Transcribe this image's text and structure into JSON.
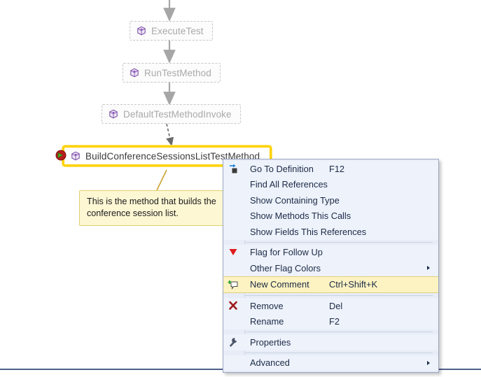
{
  "canvas": {
    "background": "#ffffff",
    "accent_highlight": "#ffd200",
    "comment_fill": "#fdf7d4",
    "comment_border": "#e0d070",
    "node_text": "#a9a9a9",
    "menu_bg": "#eef2fb",
    "menu_border": "#9ba7bf",
    "menu_highlight": "#fdf3c2"
  },
  "graph": {
    "nodes": [
      {
        "id": "execute-test",
        "label": "ExecuteTest",
        "icon": "method-cube-icon",
        "state": "dimmed"
      },
      {
        "id": "run-test-method",
        "label": "RunTestMethod",
        "icon": "method-cube-icon",
        "state": "dimmed"
      },
      {
        "id": "default-test-method-invoke",
        "label": "DefaultTestMethodInvoke",
        "icon": "method-cube-icon",
        "state": "dimmed"
      },
      {
        "id": "build-conference-sessions-list-test-method",
        "label": "BuildConferenceSessionsListTestMethod",
        "icon": "method-cube-icon",
        "state": "selected"
      }
    ],
    "breakpoint": {
      "name": "current-statement-icon",
      "title": "Current statement"
    }
  },
  "comment": {
    "line1": "This is the method that builds the",
    "line2": "conference session list."
  },
  "context_menu": {
    "groups": [
      {
        "items": [
          {
            "label": "Go To Definition",
            "shortcut": "F12",
            "icon": "go-to-definition-icon",
            "submenu": false,
            "highlighted": false
          },
          {
            "label": "Find All References",
            "shortcut": "",
            "icon": "",
            "submenu": false,
            "highlighted": false
          },
          {
            "label": "Show Containing Type",
            "shortcut": "",
            "icon": "",
            "submenu": false,
            "highlighted": false
          },
          {
            "label": "Show Methods This Calls",
            "shortcut": "",
            "icon": "",
            "submenu": false,
            "highlighted": false
          },
          {
            "label": "Show Fields This References",
            "shortcut": "",
            "icon": "",
            "submenu": false,
            "highlighted": false
          }
        ]
      },
      {
        "items": [
          {
            "label": "Flag for Follow Up",
            "shortcut": "",
            "icon": "red-flag-icon",
            "submenu": false,
            "highlighted": false
          },
          {
            "label": "Other Flag Colors",
            "shortcut": "",
            "icon": "",
            "submenu": true,
            "highlighted": false
          },
          {
            "label": "New Comment",
            "shortcut": "Ctrl+Shift+K",
            "icon": "new-comment-icon",
            "submenu": false,
            "highlighted": true
          }
        ]
      },
      {
        "items": [
          {
            "label": "Remove",
            "shortcut": "Del",
            "icon": "remove-x-icon",
            "submenu": false,
            "highlighted": false
          },
          {
            "label": "Rename",
            "shortcut": "F2",
            "icon": "",
            "submenu": false,
            "highlighted": false
          }
        ]
      },
      {
        "items": [
          {
            "label": "Properties",
            "shortcut": "",
            "icon": "wrench-icon",
            "submenu": false,
            "highlighted": false
          }
        ]
      },
      {
        "items": [
          {
            "label": "Advanced",
            "shortcut": "",
            "icon": "",
            "submenu": true,
            "highlighted": false
          }
        ]
      }
    ]
  }
}
